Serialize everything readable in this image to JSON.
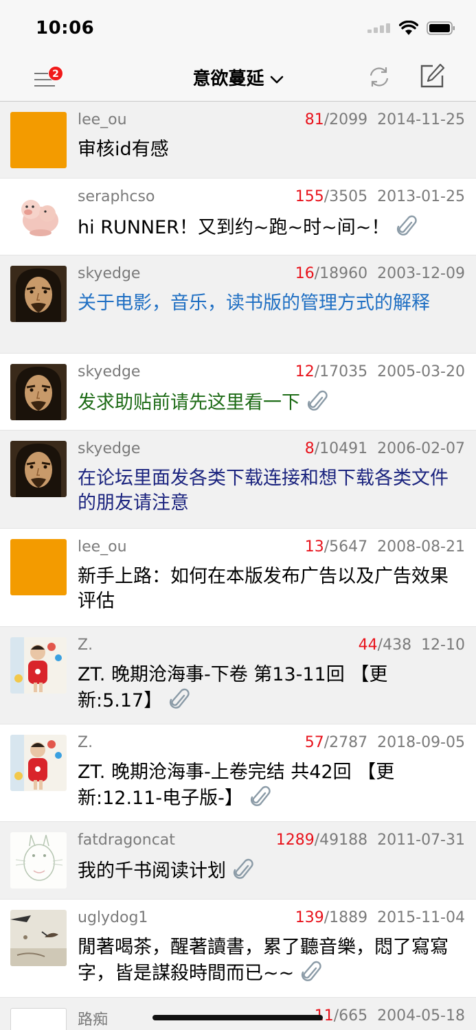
{
  "status": {
    "time": "10:06"
  },
  "header": {
    "title": "意欲蔓延",
    "badge_count": "2"
  },
  "colors": {
    "accent_red": "#e8121b",
    "blue_title": "#1f6fc3",
    "green_title": "#1d6b16",
    "navy_title": "#1a237e"
  },
  "rows": [
    {
      "author": "lee_ou",
      "replies": "81",
      "views": "/2099",
      "date": "2014-11-25",
      "title": "审核id有感",
      "color": "default",
      "attachment": false,
      "avatar": "orange"
    },
    {
      "author": "seraphcso",
      "replies": "155",
      "views": "/3505",
      "date": "2013-01-25",
      "title": "hi RUNNER！又到约~跑~时~间~！",
      "color": "default",
      "attachment": true,
      "avatar": "pig"
    },
    {
      "author": "skyedge",
      "replies": "16",
      "views": "/18960",
      "date": "2003-12-09",
      "title": "关于电影，音乐，读书版的管理方式的解释",
      "color": "blue",
      "attachment": false,
      "avatar": "face"
    },
    {
      "author": "skyedge",
      "replies": "12",
      "views": "/17035",
      "date": "2005-03-20",
      "title": "发求助贴前请先这里看一下",
      "color": "green",
      "attachment": true,
      "avatar": "face"
    },
    {
      "author": "skyedge",
      "replies": "8",
      "views": "/10491",
      "date": "2006-02-07",
      "title": "在论坛里面发各类下载连接和想下载各类文件的朋友请注意",
      "color": "navy",
      "attachment": false,
      "avatar": "face"
    },
    {
      "author": "lee_ou",
      "replies": "13",
      "views": "/5647",
      "date": "2008-08-21",
      "title": "新手上路：如何在本版发布广告以及广告效果评估",
      "color": "default",
      "attachment": false,
      "avatar": "orange"
    },
    {
      "author": "Z.",
      "replies": "44",
      "views": "/438",
      "date": "12-10",
      "title": "ZT. 晚期沧海事-下卷 第13-11回 【更新:5.17】",
      "color": "default",
      "attachment": true,
      "avatar": "baby"
    },
    {
      "author": "Z.",
      "replies": "57",
      "views": "/2787",
      "date": "2018-09-05",
      "title": "ZT. 晚期沧海事-上卷完结 共42回 【更新:12.11-电子版-】",
      "color": "default",
      "attachment": true,
      "avatar": "baby"
    },
    {
      "author": "fatdragoncat",
      "replies": "1289",
      "views": "/49188",
      "date": "2011-07-31",
      "title": "我的千书阅读计划",
      "color": "default",
      "attachment": true,
      "avatar": "sketch"
    },
    {
      "author": "uglydog1",
      "replies": "139",
      "views": "/1889",
      "date": "2015-11-04",
      "title": "閒著喝茶，醒著讀書，累了聽音樂，悶了寫寫字，皆是謀殺時間而已~~",
      "color": "default",
      "attachment": true,
      "avatar": "bird"
    },
    {
      "author": "路痴",
      "replies": "11",
      "views": "/665",
      "date": "2004-05-18",
      "title": "",
      "color": "default",
      "attachment": false,
      "avatar": "blank"
    }
  ]
}
